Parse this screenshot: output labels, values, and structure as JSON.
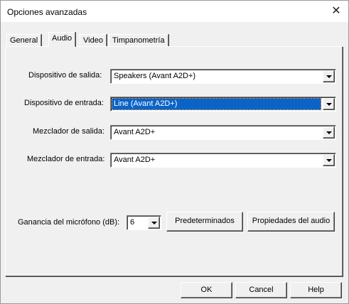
{
  "window": {
    "title": "Opciones avanzadas",
    "close_glyph": "✕"
  },
  "tabs": [
    {
      "label": "General"
    },
    {
      "label": "Audio",
      "active": true
    },
    {
      "label": "Video"
    },
    {
      "label": "Timpanometría"
    }
  ],
  "audio": {
    "output_device": {
      "label": "Dispositivo de salida:",
      "value": "Speakers (Avant A2D+)"
    },
    "input_device": {
      "label": "Dispositivo de entrada:",
      "value": "Line (Avant A2D+)"
    },
    "output_mixer": {
      "label": "Mezclador de salida:",
      "value": "Avant A2D+"
    },
    "input_mixer": {
      "label": "Mezclador de entrada:",
      "value": "Avant A2D+"
    },
    "mic_gain": {
      "label": "Ganancia del micrófono (dB):",
      "value": "6"
    },
    "defaults_button": "Predeterminados",
    "audio_properties_button": "Propiedades del audio"
  },
  "footer": {
    "ok_label": "OK",
    "cancel_label": "Cancel",
    "help_label": "Help"
  },
  "icons": {
    "close": "close-icon",
    "dropdown": "chevron-down-icon"
  },
  "colors": {
    "selection": "#0a64c8",
    "face": "#f0f0f0"
  }
}
